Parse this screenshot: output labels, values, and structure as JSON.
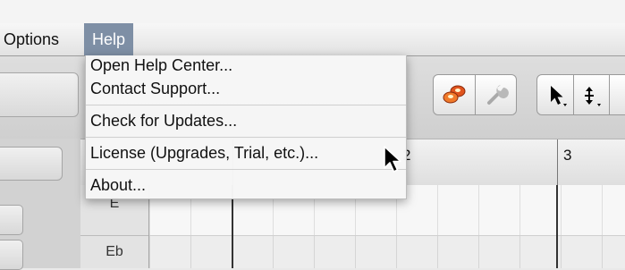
{
  "menubar": {
    "items": [
      {
        "label": "Options"
      },
      {
        "label": "Help"
      }
    ]
  },
  "help_menu": {
    "items": [
      {
        "label": "Open Help Center..."
      },
      {
        "label": "Contact Support..."
      },
      {
        "label": "Check for Updates..."
      },
      {
        "label": "License (Upgrades, Trial, etc.)..."
      },
      {
        "label": "About..."
      }
    ]
  },
  "ruler": {
    "markers": [
      "2",
      "3"
    ]
  },
  "piano_keys": [
    "E",
    "Eb"
  ],
  "toolbar": {
    "icons": [
      "mixer-icon",
      "wrench-icon",
      "pointer-tool-icon",
      "resize-tool-icon"
    ]
  },
  "colors": {
    "help_highlight": "#7e8fa5",
    "menu_background": "#f6f6f6",
    "toolbar_accent": "#e0541e"
  }
}
